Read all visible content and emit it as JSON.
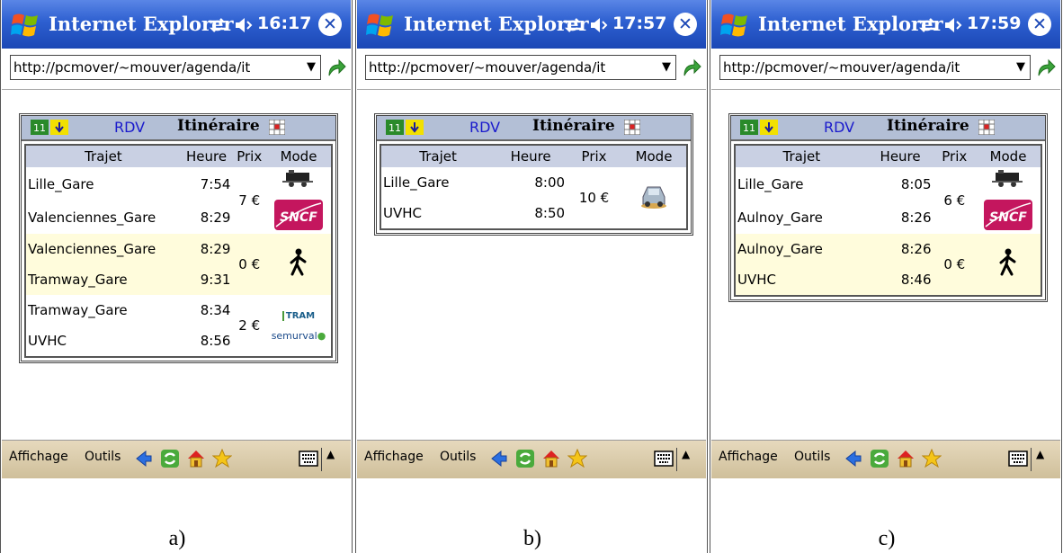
{
  "panels": [
    {
      "app_title": "Internet Explorer",
      "time": "16:17",
      "url": "http://pcmover/~mouver/agenda/it",
      "nav": {
        "rdv": "RDV",
        "itineraire": "Itinéraire"
      },
      "headers": [
        "Trajet",
        "Heure",
        "Prix",
        "Mode"
      ],
      "legs": [
        {
          "from": "Lille_Gare",
          "dep": "7:54",
          "to": "Valenciennes_Gare",
          "arr": "8:29",
          "price": "7 €",
          "mode": "train",
          "mode_label": "SNCF"
        },
        {
          "from": "Valenciennes_Gare",
          "dep": "8:29",
          "to": "Tramway_Gare",
          "arr": "9:31",
          "price": "0 €",
          "mode": "walk",
          "mode_label": ""
        },
        {
          "from": "Tramway_Gare",
          "dep": "8:34",
          "to": "UVHC",
          "arr": "8:56",
          "price": "2 €",
          "mode": "tram",
          "mode_label": "TRAM",
          "mode_label2": "semurval"
        }
      ],
      "menu": {
        "affichage": "Affichage",
        "outils": "Outils"
      },
      "caption": "a)"
    },
    {
      "app_title": "Internet Explorer",
      "time": "17:57",
      "url": "http://pcmover/~mouver/agenda/it",
      "nav": {
        "rdv": "RDV",
        "itineraire": "Itinéraire"
      },
      "headers": [
        "Trajet",
        "Heure",
        "Prix",
        "Mode"
      ],
      "legs": [
        {
          "from": "Lille_Gare",
          "dep": "8:00",
          "to": "UVHC",
          "arr": "8:50",
          "price": "10 €",
          "mode": "car",
          "mode_label": ""
        }
      ],
      "menu": {
        "affichage": "Affichage",
        "outils": "Outils"
      },
      "caption": "b)"
    },
    {
      "app_title": "Internet Explorer",
      "time": "17:59",
      "url": "http://pcmover/~mouver/agenda/it",
      "nav": {
        "rdv": "RDV",
        "itineraire": "Itinéraire"
      },
      "headers": [
        "Trajet",
        "Heure",
        "Prix",
        "Mode"
      ],
      "legs": [
        {
          "from": "Lille_Gare",
          "dep": "8:05",
          "to": "Aulnoy_Gare",
          "arr": "8:26",
          "price": "6 €",
          "mode": "train",
          "mode_label": "SNCF"
        },
        {
          "from": "Aulnoy_Gare",
          "dep": "8:26",
          "to": "UVHC",
          "arr": "8:46",
          "price": "0 €",
          "mode": "walk",
          "mode_label": ""
        }
      ],
      "menu": {
        "affichage": "Affichage",
        "outils": "Outils"
      },
      "caption": "c)"
    }
  ],
  "colors": {
    "titlebar": "#2d5fd0",
    "nav_bg": "#b3bfd6",
    "table_header": "#c9d0e3",
    "alt_row": "#fffcdc",
    "link": "#1a1acc",
    "bottombar": "#d9cba8"
  }
}
